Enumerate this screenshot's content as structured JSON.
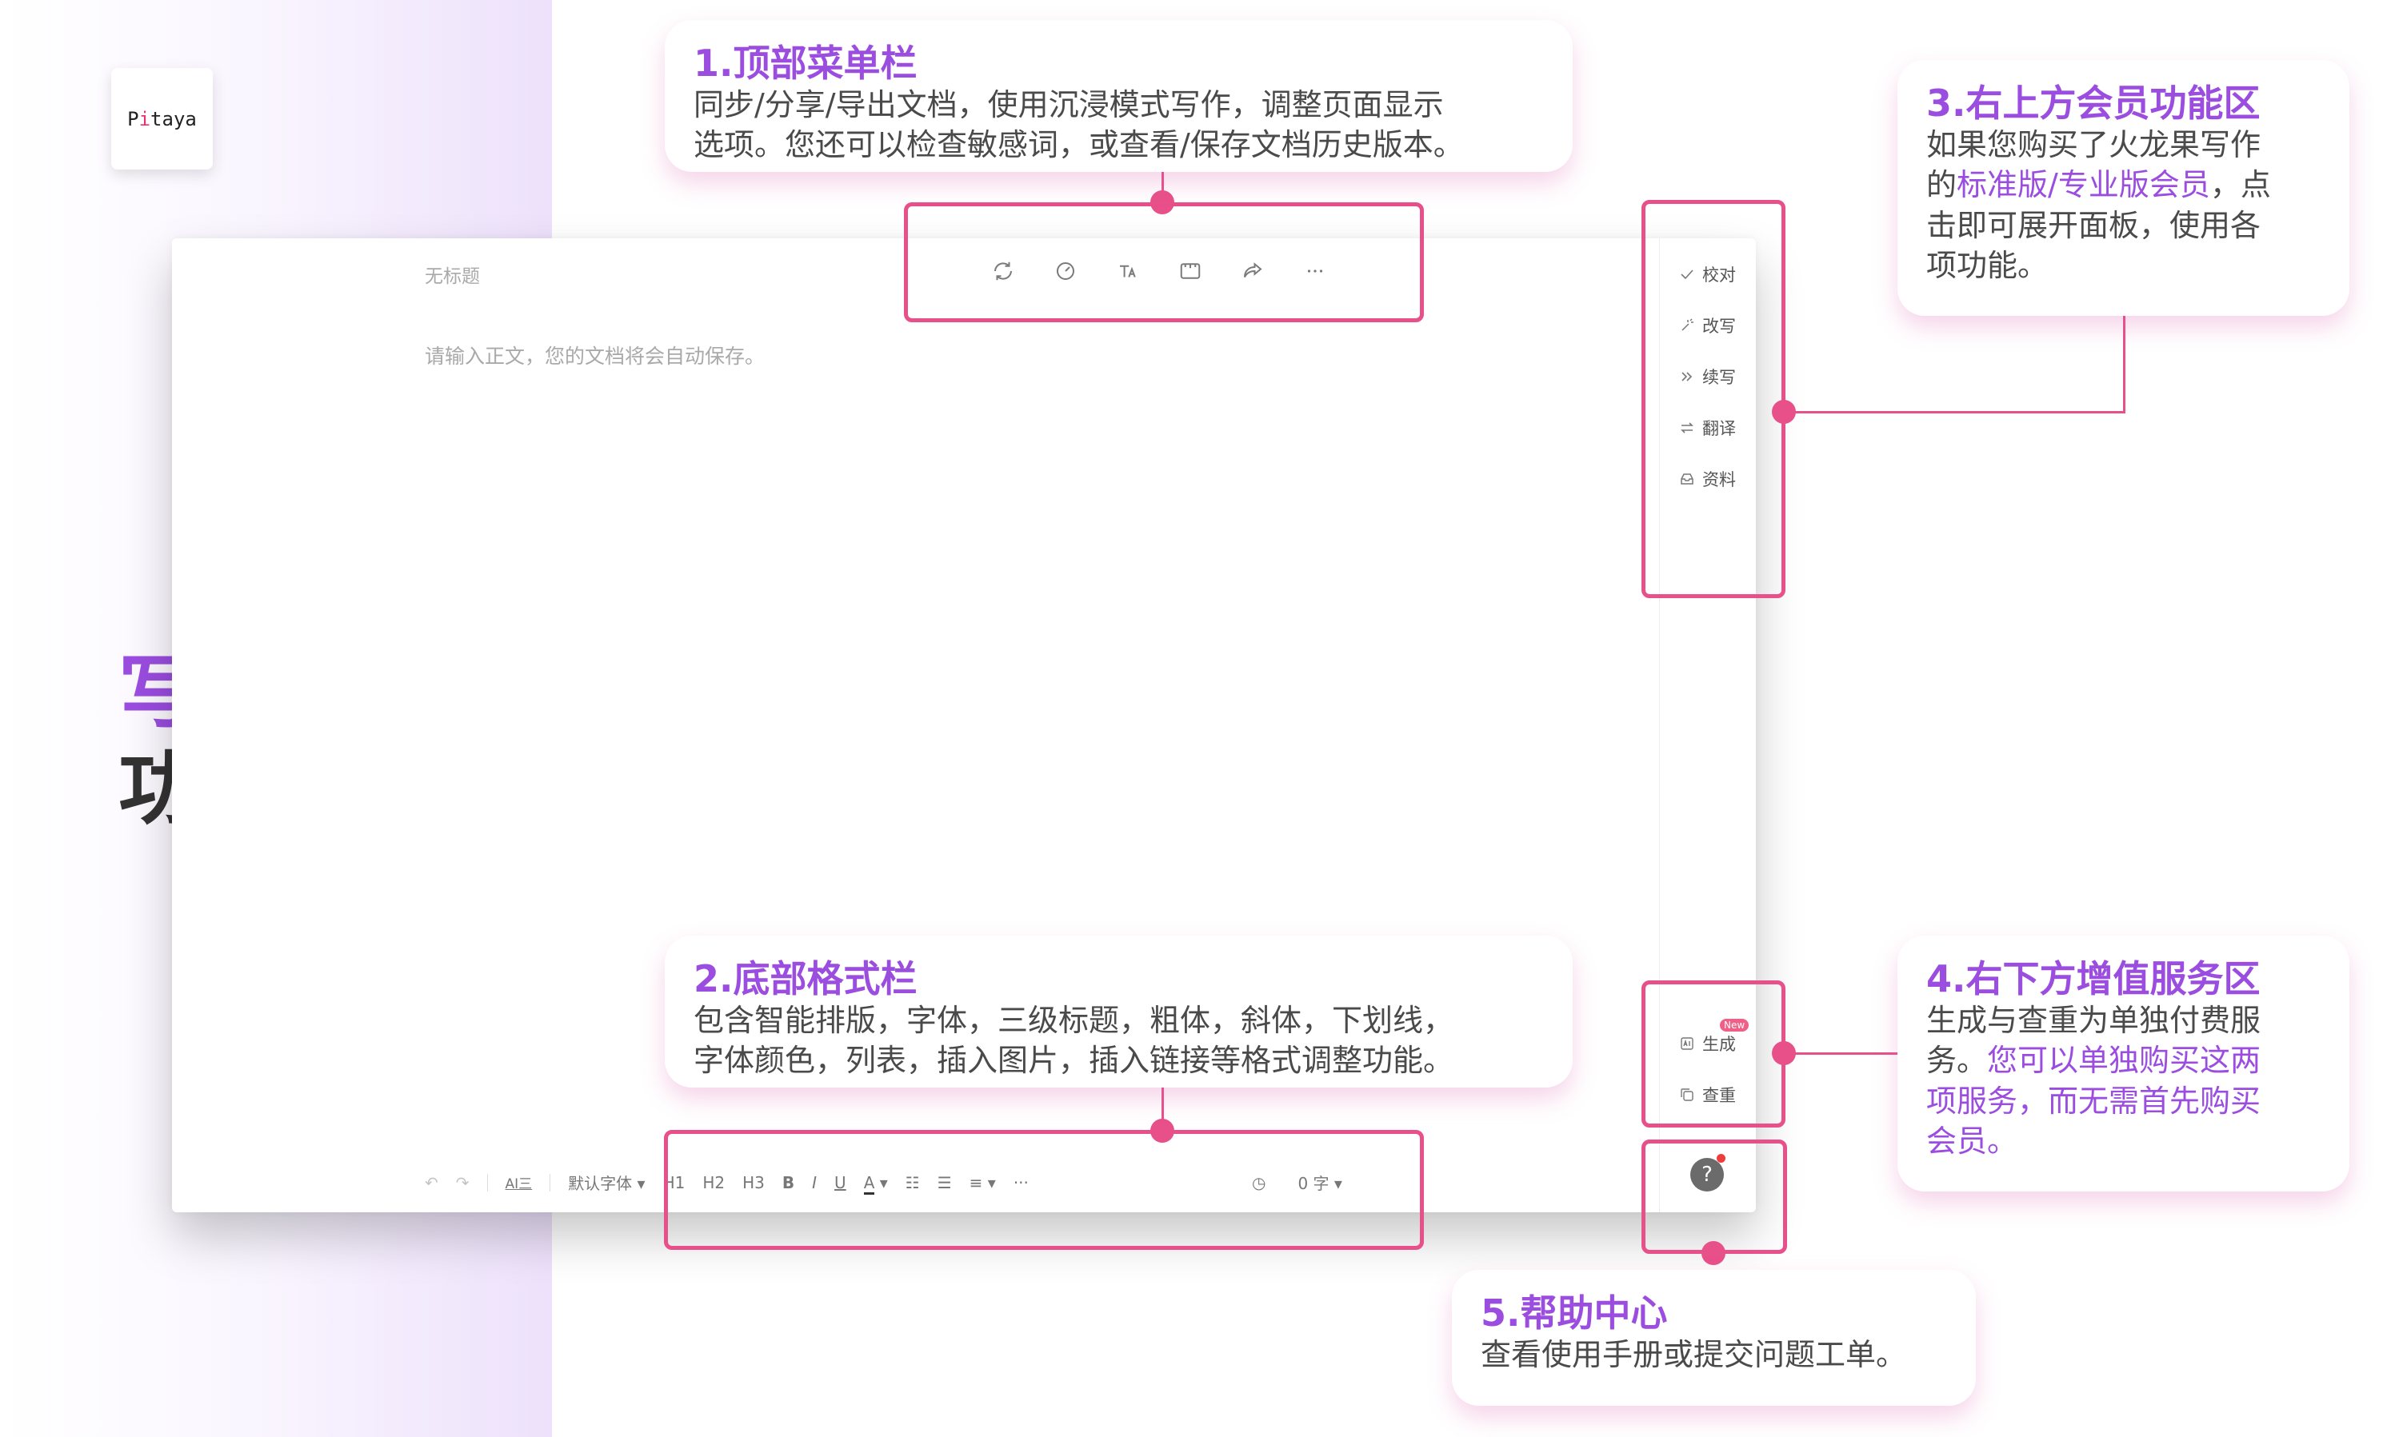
{
  "brand": {
    "logo_text_a": "P",
    "logo_text_i": "i",
    "logo_text_b": "taya"
  },
  "page_title": {
    "line1": "写作页面",
    "line2": "功能介绍"
  },
  "editor": {
    "doc_title": "无标题",
    "doc_placeholder": "请输入正文，您的文档将会自动保存。",
    "top_toolbar_icons": [
      "sync-icon",
      "timer-icon",
      "font-size-icon",
      "theme-icon",
      "share-icon",
      "more-icon"
    ],
    "right_menu": [
      {
        "icon": "check-icon",
        "label": "校对"
      },
      {
        "icon": "sparkle-icon",
        "label": "改写"
      },
      {
        "icon": "double-chevron-icon",
        "label": "续写"
      },
      {
        "icon": "swap-icon",
        "label": "翻译"
      },
      {
        "icon": "inbox-icon",
        "label": "资料"
      }
    ],
    "service_menu": [
      {
        "icon": "ai-icon",
        "label": "生成"
      },
      {
        "icon": "copy-icon",
        "label": "查重"
      }
    ],
    "new_badge": "New",
    "help_label": "?",
    "bottom_bar": {
      "smart_format": "AI三",
      "font": "默认字体",
      "h1": "H1",
      "h2": "H2",
      "h3": "H3",
      "bold": "B",
      "italic": "I",
      "underline": "U",
      "color": "A",
      "more": "···",
      "word_count": "0 字"
    }
  },
  "callouts": {
    "top_menu": {
      "title": "1.顶部菜单栏",
      "line1": "同步/分享/导出文档，使用沉浸模式写作，调整页面显示",
      "line2": "选项。您还可以检查敏感词，或查看/保存文档历史版本。"
    },
    "bottom_format": {
      "title": "2.底部格式栏",
      "line1": "包含智能排版，字体，三级标题，粗体，斜体，下划线，",
      "line2": "字体颜色，列表，插入图片，插入链接等格式调整功能。"
    },
    "member_area": {
      "title": "3.右上方会员功能区",
      "line1": "如果您购买了火龙果写作",
      "line2_pre": "的",
      "line2_hl": "标准版/专业版会员",
      "line2_post": "，点",
      "line3": "击即可展开面板，使用各",
      "line4": "项功能。"
    },
    "value_service": {
      "title": "4.右下方增值服务区",
      "line1": "生成与查重为单独付费服",
      "line2_pre": "务。",
      "line2_hl": "您可以单独购买这两",
      "line3_hl": "项服务，而无需首先购买",
      "line4_hl": "会员。"
    },
    "help_center": {
      "title": "5.帮助中心",
      "line1": "查看使用手册或提交问题工单。"
    }
  },
  "colors": {
    "accent_purple": "#9b4de0",
    "highlight_pink": "#e8508a",
    "text_dark": "#333333"
  }
}
